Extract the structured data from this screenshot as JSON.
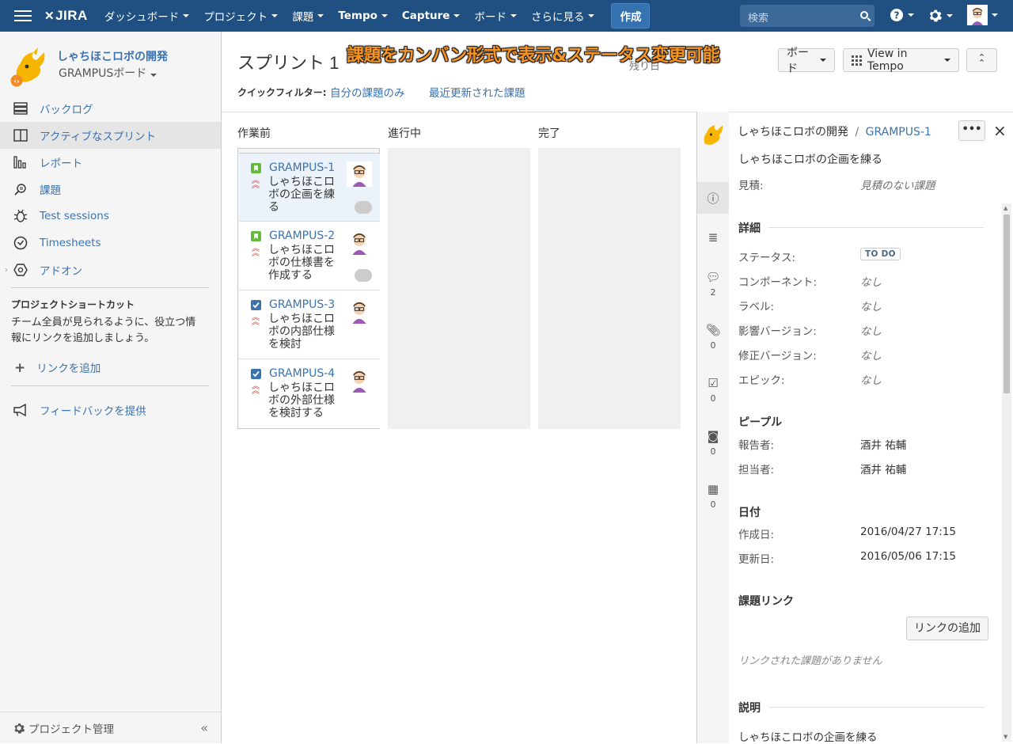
{
  "topbar": {
    "logo": "JIRA",
    "nav": [
      {
        "label": "ダッシュボード",
        "bold": false
      },
      {
        "label": "プロジェクト",
        "bold": false
      },
      {
        "label": "課題",
        "bold": false
      },
      {
        "label": "Tempo",
        "bold": true
      },
      {
        "label": "Capture",
        "bold": true
      },
      {
        "label": "ボード",
        "bold": false
      },
      {
        "label": "さらに見る",
        "bold": false
      }
    ],
    "create_label": "作成",
    "search_placeholder": "検索"
  },
  "sidebar": {
    "project_name": "しゃちほこロボの開発",
    "board_name": "GRAMPUSボード",
    "items": [
      {
        "label": "バックログ",
        "icon": "backlog-icon"
      },
      {
        "label": "アクティブなスプリント",
        "icon": "sprint-icon"
      },
      {
        "label": "レポート",
        "icon": "report-icon"
      },
      {
        "label": "課題",
        "icon": "issues-icon"
      },
      {
        "label": "Test sessions",
        "icon": "bug-icon"
      },
      {
        "label": "Timesheets",
        "icon": "clock-icon"
      },
      {
        "label": "アドオン",
        "icon": "addon-icon"
      }
    ],
    "shortcut_title": "プロジェクトショートカット",
    "shortcut_text": "チーム全員が見られるように、役立つ情報にリンクを追加しましょう。",
    "add_link": "リンクを追加",
    "feedback": "フィードバックを提供",
    "admin": "プロジェクト管理"
  },
  "board": {
    "title": "スプリント 1",
    "overlay_caption": "課題をカンバン形式で表示&ステータス変更可能",
    "remaining": "残り日",
    "board_btn": "ボード",
    "tempo_btn": "View in Tempo",
    "quick_filter_label": "クイックフィルター:",
    "filters": [
      "自分の課題のみ",
      "最近更新された課題"
    ],
    "columns": [
      "作業前",
      "進行中",
      "完了"
    ],
    "cards": [
      {
        "key": "GRAMPUS-1",
        "summary": "しゃちほこロボの企画を練る",
        "type": "story",
        "selected": true
      },
      {
        "key": "GRAMPUS-2",
        "summary": "しゃちほこロボの仕様書を作成する",
        "type": "story",
        "selected": false
      },
      {
        "key": "GRAMPUS-3",
        "summary": "しゃちほこロボの内部仕様を検討",
        "type": "task",
        "selected": false
      },
      {
        "key": "GRAMPUS-4",
        "summary": "しゃちほこロボの外部仕様を検討する",
        "type": "task",
        "selected": false
      }
    ]
  },
  "detail": {
    "project": "しゃちほこロボの開発",
    "sep": "/",
    "key": "GRAMPUS-1",
    "summary": "しゃちほこロボの企画を練る",
    "estimate_label": "見積:",
    "estimate_value": "見積のない課題",
    "rail_counts": [
      "2",
      "0",
      "0",
      "0",
      "0"
    ],
    "details_title": "詳細",
    "fields": [
      {
        "label": "ステータス:",
        "value": "TO DO"
      },
      {
        "label": "コンポーネント:",
        "value": "なし"
      },
      {
        "label": "ラベル:",
        "value": "なし"
      },
      {
        "label": "影響バージョン:",
        "value": "なし"
      },
      {
        "label": "修正バージョン:",
        "value": "なし"
      },
      {
        "label": "エピック:",
        "value": "なし"
      }
    ],
    "people_title": "ピープル",
    "people": [
      {
        "label": "報告者:",
        "value": "酒井 祐輔"
      },
      {
        "label": "担当者:",
        "value": "酒井 祐輔"
      }
    ],
    "dates_title": "日付",
    "dates": [
      {
        "label": "作成日:",
        "value": "2016/04/27 17:15"
      },
      {
        "label": "更新日:",
        "value": "2016/05/06 17:15"
      }
    ],
    "links_title": "課題リンク",
    "add_link_btn": "リンクの追加",
    "no_links": "リンクされた課題がありません",
    "desc_title": "説明",
    "desc_text": "しゃちほこロボの企画を練る"
  },
  "colors": {
    "topbar": "#205081",
    "link": "#3b73af",
    "story": "#63ba3c",
    "task": "#4a6785",
    "priority": "#d04437"
  }
}
